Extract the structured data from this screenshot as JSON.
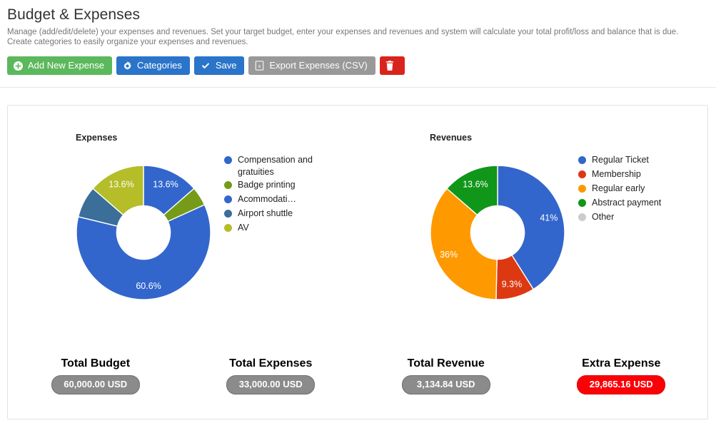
{
  "header": {
    "title": "Budget & Expenses",
    "description": "Manage (add/edit/delete) your expenses and revenues. Set your target budget, enter your expenses and revenues and system will calculate your total profit/loss and balance that is due. Create categories to easily organize your expenses and revenues."
  },
  "toolbar": {
    "add_expense_label": "Add New Expense",
    "categories_label": "Categories",
    "save_label": "Save",
    "export_label": "Export Expenses (CSV)",
    "delete_label": "",
    "icons": {
      "add": "plus-circle-icon",
      "categories": "gear-icon",
      "save": "check-icon",
      "export": "spreadsheet-file-icon",
      "delete": "trash-icon"
    },
    "colors": {
      "green": "#5cb85c",
      "blue": "#2a74c9",
      "gray": "#999999",
      "red": "#d9241e"
    }
  },
  "chart_data": [
    {
      "type": "pie",
      "variant": "donut",
      "title": "Expenses",
      "categories": [
        "Compensation and gratuities",
        "Badge printing",
        "Acommodati…",
        "Airport shuttle",
        "AV"
      ],
      "values": [
        13.6,
        4.6,
        60.6,
        7.6,
        13.6
      ],
      "labels": [
        "13.6%",
        "",
        "60.6%",
        "",
        "13.6%"
      ],
      "colors": [
        "#3366cc",
        "#769b18",
        "#3366cc",
        "#3b6e99",
        "#b5bd28"
      ],
      "legend_position": "right",
      "hole_ratio": 0.4
    },
    {
      "type": "pie",
      "variant": "donut",
      "title": "Revenues",
      "categories": [
        "Regular Ticket",
        "Membership",
        "Regular early",
        "Abstract payment",
        "Other"
      ],
      "values": [
        41,
        9.3,
        36,
        13.6,
        0
      ],
      "labels": [
        "41%",
        "9.3%",
        "36%",
        "13.6%",
        ""
      ],
      "colors": [
        "#3366cc",
        "#dc3912",
        "#ff9900",
        "#109618",
        "#cccccc"
      ],
      "legend_position": "right",
      "hole_ratio": 0.4
    }
  ],
  "totals": [
    {
      "label": "Total Budget",
      "value": "60,000.00 USD",
      "style": "gray"
    },
    {
      "label": "Total Expenses",
      "value": "33,000.00 USD",
      "style": "gray"
    },
    {
      "label": "Total Revenue",
      "value": "3,134.84 USD",
      "style": "gray"
    },
    {
      "label": "Extra Expense",
      "value": "29,865.16 USD",
      "style": "red"
    }
  ]
}
